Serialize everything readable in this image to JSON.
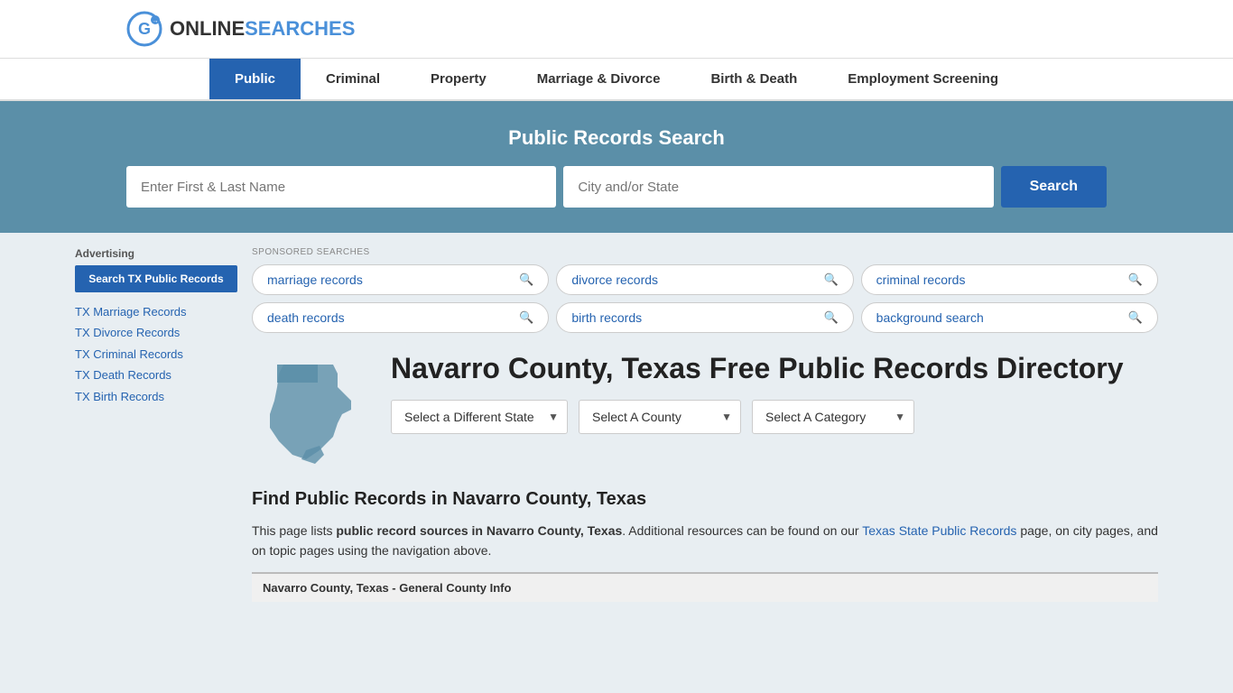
{
  "logo": {
    "text_online": "ONLINE",
    "text_searches": "SEARCHES",
    "icon_label": "logo-icon"
  },
  "nav": {
    "items": [
      {
        "label": "Public",
        "active": true
      },
      {
        "label": "Criminal",
        "active": false
      },
      {
        "label": "Property",
        "active": false
      },
      {
        "label": "Marriage & Divorce",
        "active": false
      },
      {
        "label": "Birth & Death",
        "active": false
      },
      {
        "label": "Employment Screening",
        "active": false
      }
    ]
  },
  "hero": {
    "title": "Public Records Search",
    "name_placeholder": "Enter First & Last Name",
    "location_placeholder": "City and/or State",
    "search_button": "Search"
  },
  "sponsored": {
    "label": "SPONSORED SEARCHES",
    "tags": [
      {
        "label": "marriage records"
      },
      {
        "label": "divorce records"
      },
      {
        "label": "criminal records"
      },
      {
        "label": "death records"
      },
      {
        "label": "birth records"
      },
      {
        "label": "background search"
      }
    ]
  },
  "county": {
    "title": "Navarro County, Texas Free Public Records Directory",
    "dropdowns": {
      "state_label": "Select a Different State",
      "county_label": "Select A County",
      "category_label": "Select A Category"
    }
  },
  "find_section": {
    "title": "Find Public Records in Navarro County, Texas",
    "description_part1": "This page lists ",
    "description_bold": "public record sources in Navarro County, Texas",
    "description_part2": ". Additional resources can be found on our ",
    "link_text": "Texas State Public Records",
    "description_part3": " page, on city pages, and on topic pages using the navigation above.",
    "county_info_label": "Navarro County, Texas - General County Info"
  },
  "sidebar": {
    "ad_label": "Advertising",
    "ad_button": "Search TX Public Records",
    "links": [
      "TX Marriage Records",
      "TX Divorce Records",
      "TX Criminal Records",
      "TX Death Records",
      "TX Birth Records"
    ]
  },
  "colors": {
    "primary_blue": "#2563b0",
    "hero_bg": "#5b8fa8",
    "page_bg": "#e8eef2"
  }
}
